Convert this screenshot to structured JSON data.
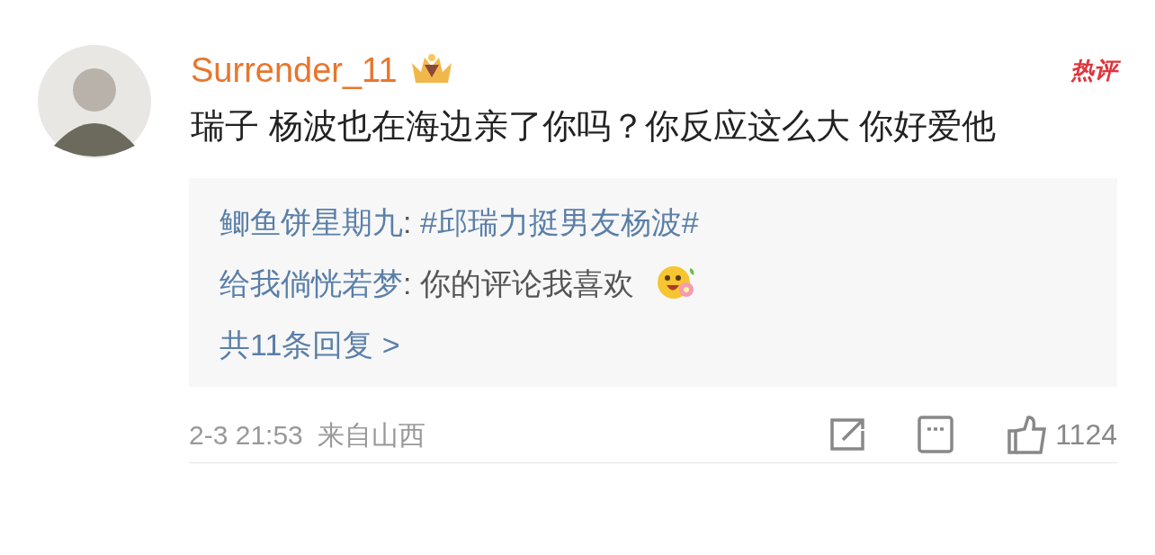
{
  "comment": {
    "username": "Surrender_11",
    "hot_badge": "热评",
    "text": "瑞子 杨波也在海边亲了你吗？你反应这么大 你好爱他"
  },
  "replies": [
    {
      "author": "鲫鱼饼星期九",
      "separator": ":",
      "text": "#邱瑞力挺男友杨波#",
      "kind": "hashtag"
    },
    {
      "author": "给我倘恍若梦",
      "separator": ":",
      "text": "你的评论我喜欢",
      "kind": "text",
      "emoji": true
    }
  ],
  "more_replies": "共11条回复 >",
  "footer": {
    "time": "2-3 21:53",
    "location": "来自山西",
    "likes": "1124"
  }
}
